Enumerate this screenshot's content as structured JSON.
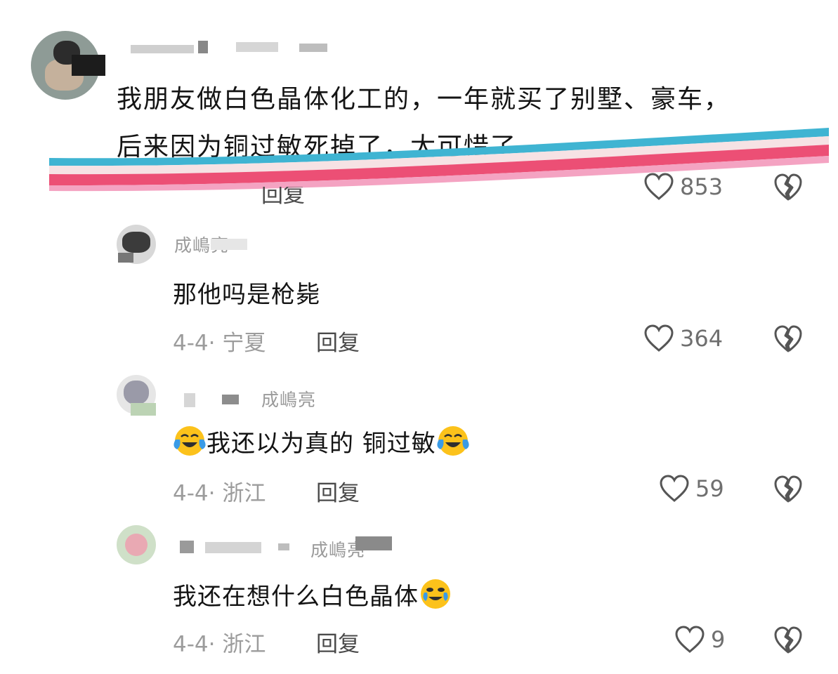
{
  "comments": [
    {
      "text_line1": "我朋友做白色晶体化工的，一年就买了别墅、豪车，",
      "text_line2": "后来因为铜过敏死掉了，太可惜了",
      "reply_label": "回复",
      "likes": "853"
    },
    {
      "username": "成嶋亮",
      "text": "那他吗是枪毙",
      "date_location": "4-4· 宁夏",
      "reply_label": "回复",
      "likes": "364"
    },
    {
      "username_suffix": "成嶋亮",
      "text": "我还以为真的 铜过敏",
      "date_location": "4-4· 浙江",
      "reply_label": "回复",
      "likes": "59"
    },
    {
      "username_suffix": "成嶋亮",
      "text": "我还在想什么白色晶体",
      "date_location": "4-4· 浙江",
      "reply_label": "回复",
      "likes": "9"
    }
  ],
  "icons": {
    "like": "heart-outline-icon",
    "dislike": "broken-heart-icon",
    "emoji_crying": "crying-laughing-emoji",
    "emoji_tears": "tears-of-joy-emoji"
  },
  "colors": {
    "stripe_blue": "#3fb4d2",
    "stripe_light": "#f6e2e4",
    "stripe_red": "#ec4f75",
    "stripe_pink": "#f4a3c2"
  }
}
